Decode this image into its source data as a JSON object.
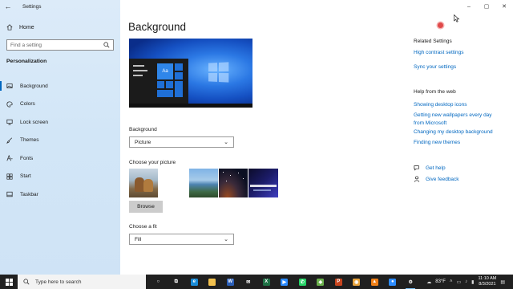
{
  "window": {
    "title": "Settings",
    "back": "←",
    "controls": {
      "minimize": "–",
      "maximize": "▢",
      "close": "✕"
    }
  },
  "sidebar": {
    "home": "Home",
    "search_placeholder": "Find a setting",
    "section": "Personalization",
    "items": [
      {
        "label": "Background",
        "icon": "image-icon",
        "active": true
      },
      {
        "label": "Colors",
        "icon": "palette-icon"
      },
      {
        "label": "Lock screen",
        "icon": "monitor-icon"
      },
      {
        "label": "Themes",
        "icon": "brush-icon"
      },
      {
        "label": "Fonts",
        "icon": "font-icon"
      },
      {
        "label": "Start",
        "icon": "start-icon"
      },
      {
        "label": "Taskbar",
        "icon": "taskbar-icon"
      }
    ]
  },
  "main": {
    "title": "Background",
    "preview_tile_text": "Aa",
    "background_label": "Background",
    "background_value": "Picture",
    "choose_picture_label": "Choose your picture",
    "browse": "Browse",
    "fit_label": "Choose a fit",
    "fit_value": "Fill"
  },
  "related": {
    "title": "Related Settings",
    "links": [
      "High contrast settings",
      "Sync your settings"
    ]
  },
  "help": {
    "title": "Help from the web",
    "links": [
      "Showing desktop icons",
      "Getting new wallpapers every day from Microsoft",
      "Changing my desktop background",
      "Finding new themes"
    ],
    "get_help": "Get help",
    "give_feedback": "Give feedback"
  },
  "taskbar": {
    "search_placeholder": "Type here to search",
    "weather": "83°F",
    "time": "11:10 AM",
    "date": "8/3/2021",
    "apps": [
      {
        "name": "cortana-icon",
        "color": "#202020",
        "glyph": "○"
      },
      {
        "name": "task-view-icon",
        "color": "#202020",
        "glyph": "⧉"
      },
      {
        "name": "edge-icon",
        "color": "#1a8cd8",
        "glyph": "e"
      },
      {
        "name": "file-explorer-icon",
        "color": "#f2c14e",
        "glyph": ""
      },
      {
        "name": "word-icon",
        "color": "#2b5fb8",
        "glyph": "W"
      },
      {
        "name": "mail-icon",
        "color": "#202020",
        "glyph": "✉"
      },
      {
        "name": "excel-icon",
        "color": "#1e7145",
        "glyph": "X"
      },
      {
        "name": "zoom-icon",
        "color": "#2d8cff",
        "glyph": "▶"
      },
      {
        "name": "whatsapp-icon",
        "color": "#25d366",
        "glyph": "✆"
      },
      {
        "name": "bluestacks-icon",
        "color": "#6ab04c",
        "glyph": "◆"
      },
      {
        "name": "powerpoint-icon",
        "color": "#c8451f",
        "glyph": "P"
      },
      {
        "name": "chrome-icon",
        "color": "#e8a33d",
        "glyph": "◉"
      },
      {
        "name": "vlc-icon",
        "color": "#f07f16",
        "glyph": "▲"
      },
      {
        "name": "zoom-meetings-icon",
        "color": "#2d8cff",
        "glyph": "●"
      },
      {
        "name": "settings-icon",
        "color": "#202020",
        "glyph": "⚙",
        "open": true
      }
    ]
  }
}
